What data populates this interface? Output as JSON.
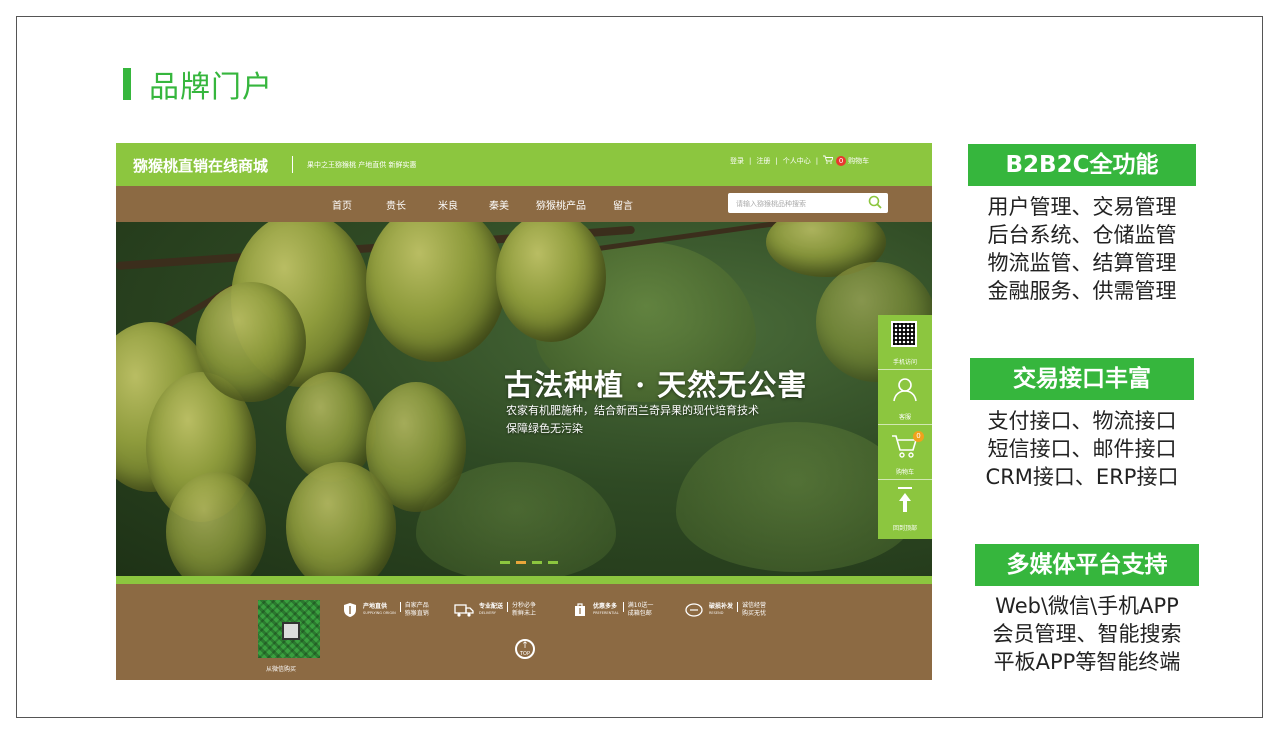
{
  "slide": {
    "title": "品牌门户"
  },
  "site": {
    "logo": "猕猴桃直销在线商城",
    "slogan": "果中之王猕猴桃 产地直供 新鲜实惠",
    "toplinks": {
      "login": "登录",
      "register": "注册",
      "account": "个人中心",
      "cart_count": "0",
      "cart": "购物车"
    },
    "nav": [
      "首页",
      "贵长",
      "米良",
      "秦美",
      "猕猴桃产品",
      "留言"
    ],
    "search": {
      "placeholder": "请输入猕猴桃品种搜索"
    },
    "banner": {
      "headline": "古法种植 · 天然无公害",
      "sub1": "农家有机肥施种，结合新西兰奇异果的现代培育技术",
      "sub2": "保障绿色无污染"
    },
    "sidebar": [
      {
        "label": "手机访问",
        "icon": "qr-code-icon"
      },
      {
        "label": "客服",
        "icon": "user-icon"
      },
      {
        "label": "购物车",
        "icon": "cart-icon",
        "badge": "0"
      },
      {
        "label": "回到顶部",
        "icon": "arrow-up-icon"
      }
    ],
    "footer": {
      "qr_caption": "从微信购买",
      "features": [
        {
          "title": "产地直供",
          "en": "SUPPLYING ORIGIN",
          "desc": "自家产品 猕猴直销",
          "icon": "shield-icon"
        },
        {
          "title": "专业配送",
          "en": "DELIVERY",
          "desc": "分秒必争 新鲜未上",
          "icon": "truck-icon"
        },
        {
          "title": "优惠多多",
          "en": "PREFERENTIAL",
          "desc": "满10送一 成箱包邮",
          "icon": "gift-icon"
        },
        {
          "title": "破损补发",
          "en": "RESEND",
          "desc": "诚信经营 购买无忧",
          "icon": "refresh-icon"
        }
      ],
      "top_label": "TOP"
    }
  },
  "features": [
    {
      "heading": "B2B2C全功能",
      "lines": [
        "用户管理、交易管理",
        "后台系统、仓储监管",
        "物流监管、结算管理",
        "金融服务、供需管理"
      ]
    },
    {
      "heading": "交易接口丰富",
      "lines": [
        "支付接口、物流接口",
        "短信接口、邮件接口",
        "CRM接口、ERP接口"
      ]
    },
    {
      "heading": "多媒体平台支持",
      "lines": [
        "Web\\微信\\手机APP",
        "会员管理、智能搜索",
        "平板APP等智能终端"
      ]
    }
  ],
  "colors": {
    "accent": "#36b63d",
    "site_green": "#8cc63f",
    "site_brown": "#8c6a43"
  }
}
